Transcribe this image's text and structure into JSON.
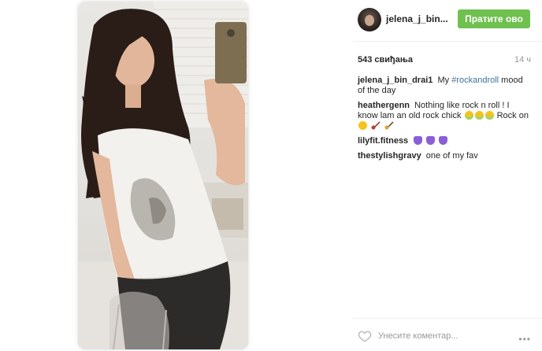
{
  "post": {
    "photo_alt": "selfie photo",
    "header": {
      "username": "jelena_j_bin...",
      "follow_label": "Пратите ово"
    },
    "stats": {
      "likes_text": "543 свиђања",
      "time_ago": "14 ч"
    },
    "caption": {
      "user": "jelena_j_bin_drai1",
      "text_before": "My",
      "hashtag": "#rockandroll",
      "text_after": "mood of the day"
    },
    "comments": [
      {
        "user": "heathergenn",
        "text": "Nothing like rock n roll ! I know lam an old rock chick",
        "text_end": "Rock on"
      },
      {
        "user": "lilyfit.fitness",
        "text": ""
      },
      {
        "user": "thestylishgravy",
        "text": "one of my fav"
      }
    ],
    "add_comment": {
      "placeholder": "Унесите коментар...",
      "more_label": "•••"
    }
  },
  "colors": {
    "follow_button": "#70c050",
    "hashtag": "#3f729b",
    "muted": "#999999"
  },
  "icons": [
    "heart-outline-icon",
    "more-options-icon",
    "grinning-emoji",
    "guitar-emoji",
    "purple-heart-emoji"
  ]
}
